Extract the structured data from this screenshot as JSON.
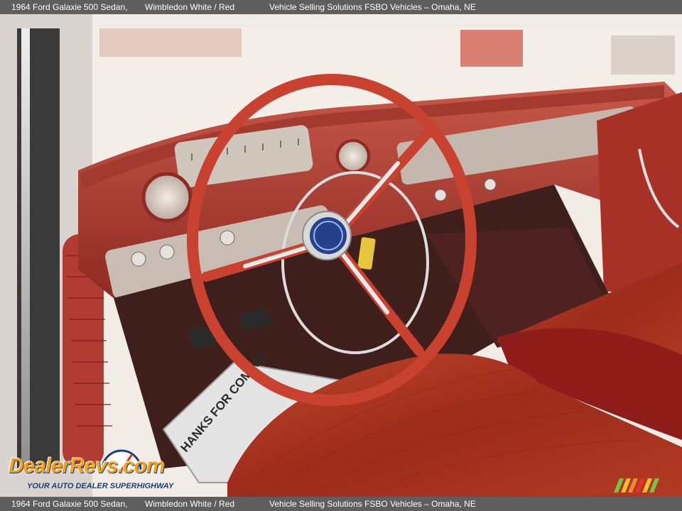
{
  "caption": {
    "vehicle": "1964 Ford Galaxie 500 Sedan,",
    "color": "Wimbledon White / Red",
    "dealer": "Vehicle Selling Solutions FSBO Vehicles – Omaha, NE"
  },
  "photo": {
    "subject": "1964 Ford Galaxie 500 Sedan interior",
    "floor_mat_text": "HANKS FOR COMING"
  },
  "watermark": {
    "logo_text": "DealerRevs.com",
    "tagline": "YOUR AUTO DEALER SUPERHIGHWAY"
  },
  "colors": {
    "caption_bar": "#5e5e5e",
    "interior_red": "#b63a2e",
    "steering_wheel": "#c9412f",
    "upholstery": "#a2301d",
    "logo_orange": "#f3a21a",
    "logo_blue": "#1c3f77"
  }
}
